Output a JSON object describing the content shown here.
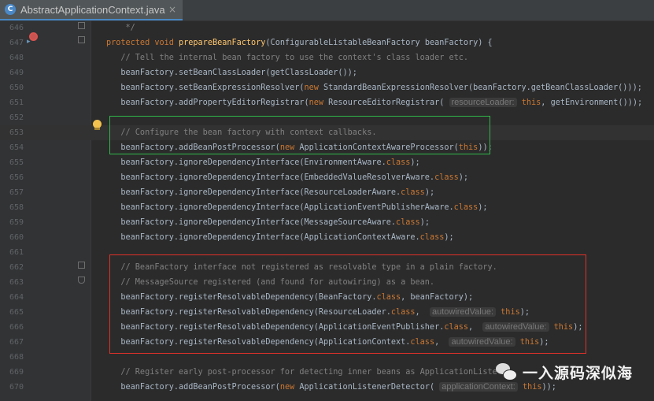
{
  "tab": {
    "icon_letter": "C",
    "title": "AbstractApplicationContext.java",
    "close": "×"
  },
  "watermark": {
    "text": "一入源码深似海"
  },
  "lines": [
    {
      "n": "646",
      "code": "<span class=\"cm\">    */</span>"
    },
    {
      "n": "647",
      "code": "<span class=\"kw\">protected void </span><span class=\"fn\">prepareBeanFactory</span>(ConfigurableListableBeanFactory beanFactory) {"
    },
    {
      "n": "648",
      "code": "<span class=\"cm\">   // Tell the internal bean factory to use the context's class loader etc.</span>"
    },
    {
      "n": "649",
      "code": "   beanFactory.setBeanClassLoader(getClassLoader());"
    },
    {
      "n": "650",
      "code": "   beanFactory.setBeanExpressionResolver(<span class=\"kw\">new </span>StandardBeanExpressionResolver(beanFactory.getBeanClassLoader()));"
    },
    {
      "n": "651",
      "code": "   beanFactory.addPropertyEditorRegistrar(<span class=\"kw\">new </span>ResourceEditorRegistrar( <span class=\"hint\">resourceLoader:</span> <span class=\"kw\">this</span>, getEnvironment()));"
    },
    {
      "n": "652",
      "code": ""
    },
    {
      "n": "653",
      "code": "<span class=\"cm\">   // Configure the bean factory with context callbacks.</span>"
    },
    {
      "n": "654",
      "code": "   beanFactory.addBeanPostProcessor(<span class=\"kw\">new </span>ApplicationContextAwareProcessor(<span class=\"kw\">this</span>));"
    },
    {
      "n": "655",
      "code": "   beanFactory.ignoreDependencyInterface(EnvironmentAware.<span class=\"cl\">class</span>);"
    },
    {
      "n": "656",
      "code": "   beanFactory.ignoreDependencyInterface(EmbeddedValueResolverAware.<span class=\"cl\">class</span>);"
    },
    {
      "n": "657",
      "code": "   beanFactory.ignoreDependencyInterface(ResourceLoaderAware.<span class=\"cl\">class</span>);"
    },
    {
      "n": "658",
      "code": "   beanFactory.ignoreDependencyInterface(ApplicationEventPublisherAware.<span class=\"cl\">class</span>);"
    },
    {
      "n": "659",
      "code": "   beanFactory.ignoreDependencyInterface(MessageSourceAware.<span class=\"cl\">class</span>);"
    },
    {
      "n": "660",
      "code": "   beanFactory.ignoreDependencyInterface(ApplicationContextAware.<span class=\"cl\">class</span>);"
    },
    {
      "n": "661",
      "code": ""
    },
    {
      "n": "662",
      "code": "<span class=\"cm\">   // BeanFactory interface not registered as resolvable type in a plain factory.</span>"
    },
    {
      "n": "663",
      "code": "<span class=\"cm\">   // MessageSource registered (and found for autowiring) as a bean.</span>"
    },
    {
      "n": "664",
      "code": "   beanFactory.registerResolvableDependency(BeanFactory.<span class=\"cl\">class</span>, beanFactory);"
    },
    {
      "n": "665",
      "code": "   beanFactory.registerResolvableDependency(ResourceLoader.<span class=\"cl\">class</span>,  <span class=\"hint\">autowiredValue:</span> <span class=\"kw\">this</span>);"
    },
    {
      "n": "666",
      "code": "   beanFactory.registerResolvableDependency(ApplicationEventPublisher.<span class=\"cl\">class</span>,  <span class=\"hint\">autowiredValue:</span> <span class=\"kw\">this</span>);"
    },
    {
      "n": "667",
      "code": "   beanFactory.registerResolvableDependency(ApplicationContext.<span class=\"cl\">class</span>,  <span class=\"hint\">autowiredValue:</span> <span class=\"kw\">this</span>);"
    },
    {
      "n": "668",
      "code": ""
    },
    {
      "n": "669",
      "code": "<span class=\"cm\">   // Register early post-processor for detecting inner beans as ApplicationListe</span>"
    },
    {
      "n": "670",
      "code": "   beanFactory.addBeanPostProcessor(<span class=\"kw\">new </span>ApplicationListenerDetector( <span class=\"hint\">applicationContext:</span> <span class=\"kw\">this</span>));"
    }
  ]
}
